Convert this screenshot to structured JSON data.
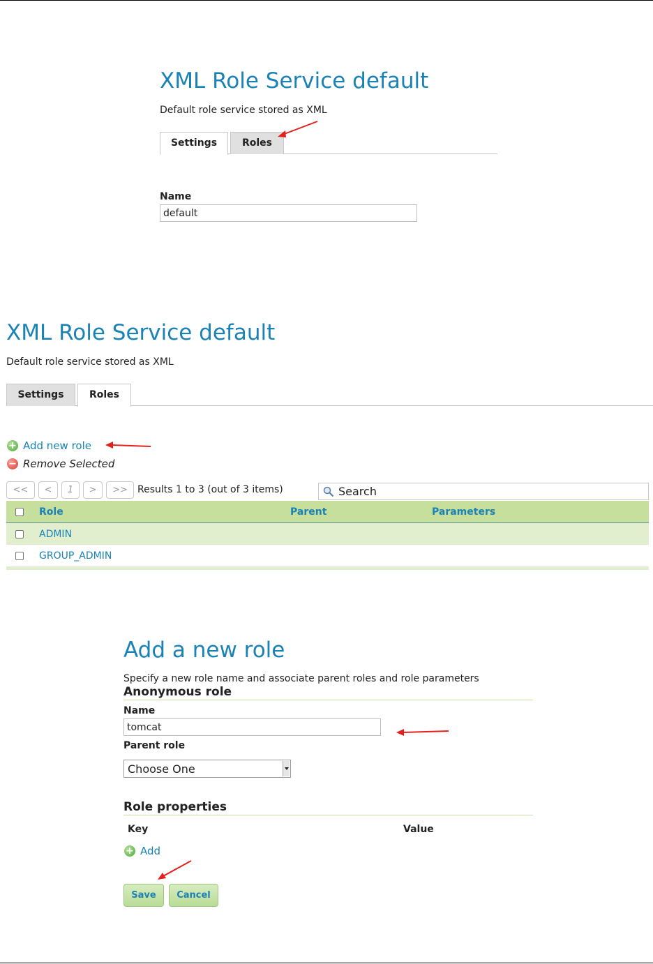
{
  "panel1": {
    "title": "XML Role Service default",
    "description": "Default role service stored as XML",
    "tabs": [
      {
        "label": "Settings",
        "active": true
      },
      {
        "label": "Roles",
        "active": false
      }
    ],
    "name_label": "Name",
    "name_value": "default"
  },
  "panel2": {
    "title": "XML Role Service default",
    "description": "Default role service stored as XML",
    "tabs": [
      {
        "label": "Settings",
        "active": false
      },
      {
        "label": "Roles",
        "active": true
      }
    ],
    "add_role_link": "Add new role",
    "remove_selected_link": "Remove Selected",
    "pager": {
      "first": "<<",
      "prev": "<",
      "page": "1",
      "next": ">",
      "last": ">>",
      "results_text": "Results 1 to 3 (out of 3 items)"
    },
    "search_placeholder": "Search",
    "table": {
      "headers": {
        "role": "Role",
        "parent": "Parent",
        "parameters": "Parameters"
      },
      "rows": [
        {
          "role": "ADMIN",
          "parent": "",
          "parameters": ""
        },
        {
          "role": "GROUP_ADMIN",
          "parent": "",
          "parameters": ""
        }
      ]
    }
  },
  "panel3": {
    "title": "Add a new role",
    "description": "Specify a new role name and associate parent roles and role parameters",
    "section_title": "Anonymous role",
    "name_label": "Name",
    "name_value": "tomcat",
    "parent_label": "Parent role",
    "parent_selected": "Choose One",
    "properties_title": "Role properties",
    "key_header": "Key",
    "value_header": "Value",
    "add_link": "Add",
    "save_label": "Save",
    "cancel_label": "Cancel"
  },
  "colors": {
    "title_blue": "#1a82b7",
    "header_green": "#c6df9c",
    "row_green": "#e1efcf",
    "annotation_red": "#e3201b"
  }
}
